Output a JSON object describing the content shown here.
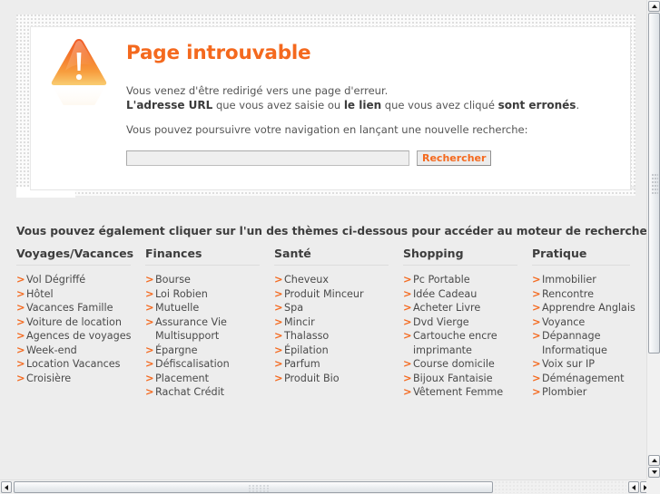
{
  "error_panel": {
    "icon": "warning-triangle-icon",
    "title": "Page introuvable",
    "paragraph1_line1": "Vous venez d'être redirigé vers une page d'erreur.",
    "paragraph1_line2_part1": "L'adresse URL",
    "paragraph1_line2_part2": " que vous avez saisie ou ",
    "paragraph1_line2_part3": "le lien",
    "paragraph1_line2_part4": " que vous avez cliqué ",
    "paragraph1_line2_part5": "sont erronés",
    "paragraph1_line2_part6": ".",
    "paragraph2": "Vous pouvez poursuivre votre navigation en lançant une nouvelle recherche:",
    "search_value": "",
    "search_placeholder": "",
    "search_button_label": "Rechercher"
  },
  "themes": {
    "intro": "Vous pouvez également cliquer sur l'un des thèmes ci-dessous pour accéder au moteur de recherche :",
    "columns": [
      {
        "heading": "Voyages/Vacances",
        "items": [
          "Vol Dégriffé",
          "Hôtel",
          "Vacances Famille",
          "Voiture de location",
          "Agences de voyages",
          "Week-end",
          "Location Vacances",
          "Croisière"
        ]
      },
      {
        "heading": "Finances",
        "items": [
          "Bourse",
          "Loi Robien",
          "Mutuelle",
          "Assurance Vie Multisupport",
          "Épargne",
          "Défiscalisation",
          "Placement",
          "Rachat Crédit"
        ]
      },
      {
        "heading": "Santé",
        "items": [
          "Cheveux",
          "Produit Minceur",
          "Spa",
          "Mincir",
          "Thalasso",
          "Épilation",
          "Parfum",
          "Produit Bio"
        ]
      },
      {
        "heading": "Shopping",
        "items": [
          "Pc Portable",
          "Idée Cadeau",
          "Acheter Livre",
          "Dvd Vierge",
          "Cartouche encre imprimante",
          "Course domicile",
          "Bijoux Fantaisie",
          "Vêtement Femme"
        ]
      },
      {
        "heading": "Pratique",
        "items": [
          "Immobilier",
          "Rencontre",
          "Apprendre Anglais",
          "Voyance",
          "Dépannage Informatique",
          "Voix sur IP",
          "Déménagement",
          "Plombier"
        ]
      }
    ]
  },
  "scrollbars": {
    "vertical_up_icon": "triangle-up-icon",
    "vertical_down_icon": "triangle-down-icon",
    "horizontal_left_icon": "triangle-left-icon",
    "horizontal_right_icon": "triangle-right-icon"
  },
  "colors": {
    "accent_orange": "#f4691e",
    "page_background": "#ededed",
    "panel_white": "#ffffff",
    "text_dark": "#3d3d3d",
    "text_body": "#555555"
  }
}
